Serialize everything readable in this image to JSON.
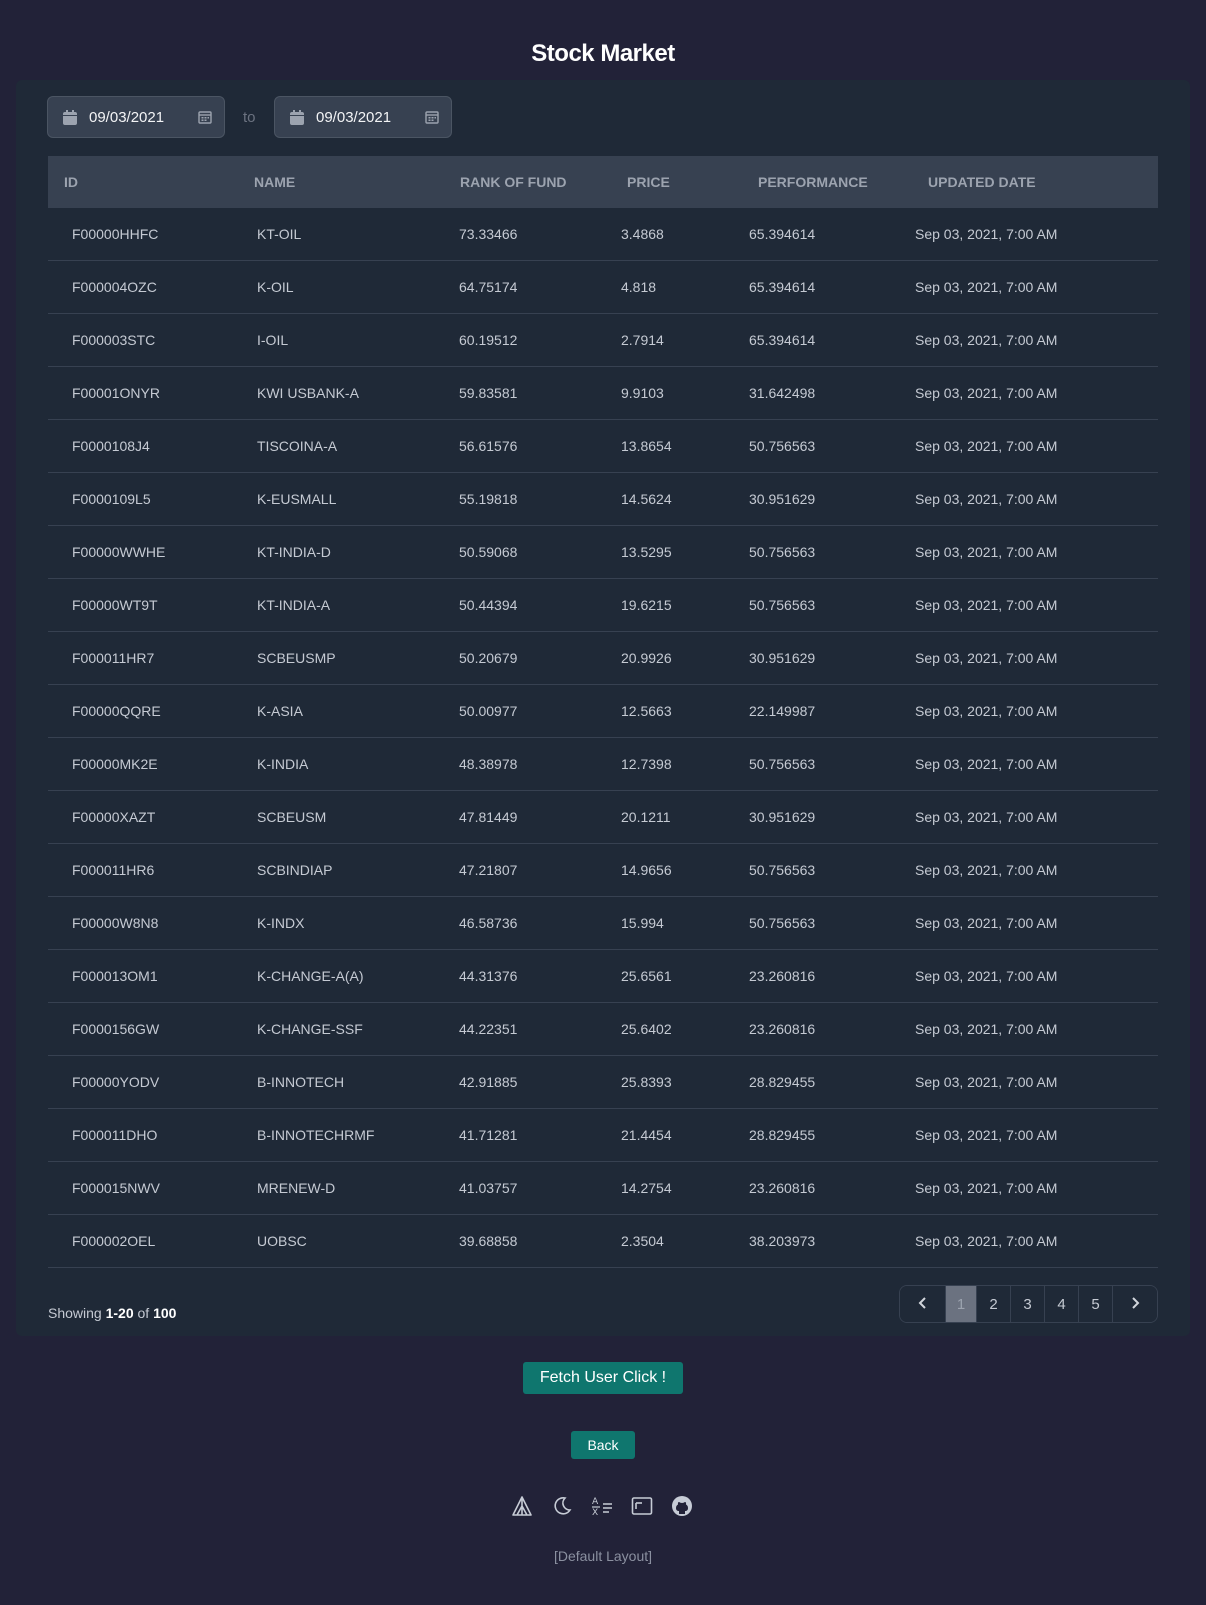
{
  "title": "Stock Market",
  "date_range": {
    "from": "09/03/2021",
    "separator": "to",
    "to": "09/03/2021"
  },
  "table": {
    "headers": [
      "ID",
      "NAME",
      "RANK OF FUND",
      "PRICE",
      "PERFORMANCE",
      "UPDATED DATE"
    ],
    "rows": [
      [
        "F00000HHFC",
        "KT-OIL",
        "73.33466",
        "3.4868",
        "65.394614",
        "Sep 03, 2021, 7:00 AM"
      ],
      [
        "F000004OZC",
        "K-OIL",
        "64.75174",
        "4.818",
        "65.394614",
        "Sep 03, 2021, 7:00 AM"
      ],
      [
        "F000003STC",
        "I-OIL",
        "60.19512",
        "2.7914",
        "65.394614",
        "Sep 03, 2021, 7:00 AM"
      ],
      [
        "F00001ONYR",
        "KWI USBANK-A",
        "59.83581",
        "9.9103",
        "31.642498",
        "Sep 03, 2021, 7:00 AM"
      ],
      [
        "F0000108J4",
        "TISCOINA-A",
        "56.61576",
        "13.8654",
        "50.756563",
        "Sep 03, 2021, 7:00 AM"
      ],
      [
        "F0000109L5",
        "K-EUSMALL",
        "55.19818",
        "14.5624",
        "30.951629",
        "Sep 03, 2021, 7:00 AM"
      ],
      [
        "F00000WWHE",
        "KT-INDIA-D",
        "50.59068",
        "13.5295",
        "50.756563",
        "Sep 03, 2021, 7:00 AM"
      ],
      [
        "F00000WT9T",
        "KT-INDIA-A",
        "50.44394",
        "19.6215",
        "50.756563",
        "Sep 03, 2021, 7:00 AM"
      ],
      [
        "F000011HR7",
        "SCBEUSMP",
        "50.20679",
        "20.9926",
        "30.951629",
        "Sep 03, 2021, 7:00 AM"
      ],
      [
        "F00000QQRE",
        "K-ASIA",
        "50.00977",
        "12.5663",
        "22.149987",
        "Sep 03, 2021, 7:00 AM"
      ],
      [
        "F00000MK2E",
        "K-INDIA",
        "48.38978",
        "12.7398",
        "50.756563",
        "Sep 03, 2021, 7:00 AM"
      ],
      [
        "F00000XAZT",
        "SCBEUSM",
        "47.81449",
        "20.1211",
        "30.951629",
        "Sep 03, 2021, 7:00 AM"
      ],
      [
        "F000011HR6",
        "SCBINDIAP",
        "47.21807",
        "14.9656",
        "50.756563",
        "Sep 03, 2021, 7:00 AM"
      ],
      [
        "F00000W8N8",
        "K-INDX",
        "46.58736",
        "15.994",
        "50.756563",
        "Sep 03, 2021, 7:00 AM"
      ],
      [
        "F000013OM1",
        "K-CHANGE-A(A)",
        "44.31376",
        "25.6561",
        "23.260816",
        "Sep 03, 2021, 7:00 AM"
      ],
      [
        "F0000156GW",
        "K-CHANGE-SSF",
        "44.22351",
        "25.6402",
        "23.260816",
        "Sep 03, 2021, 7:00 AM"
      ],
      [
        "F00000YODV",
        "B-INNOTECH",
        "42.91885",
        "25.8393",
        "28.829455",
        "Sep 03, 2021, 7:00 AM"
      ],
      [
        "F000011DHO",
        "B-INNOTECHRMF",
        "41.71281",
        "21.4454",
        "28.829455",
        "Sep 03, 2021, 7:00 AM"
      ],
      [
        "F000015NWV",
        "MRENEW-D",
        "41.03757",
        "14.2754",
        "23.260816",
        "Sep 03, 2021, 7:00 AM"
      ],
      [
        "F000002OEL",
        "UOBSC",
        "39.68858",
        "2.3504",
        "38.203973",
        "Sep 03, 2021, 7:00 AM"
      ]
    ]
  },
  "pagination": {
    "showing_prefix": "Showing",
    "range": "1-20",
    "of_label": "of",
    "total": "100",
    "pages": [
      "1",
      "2",
      "3",
      "4",
      "5"
    ],
    "active_page": "1",
    "prev_icon": "chevron-left-icon",
    "next_icon": "chevron-right-icon"
  },
  "buttons": {
    "fetch": "Fetch User Click !",
    "back": "Back"
  },
  "footer": {
    "icons": [
      "tent-icon",
      "moon-icon",
      "translate-icon",
      "layout-icon",
      "github-icon"
    ],
    "layout_label": "[Default Layout]"
  },
  "colors": {
    "accent": "#0f766e",
    "background": "#222238",
    "panel": "#1f2937",
    "header": "#374151"
  }
}
